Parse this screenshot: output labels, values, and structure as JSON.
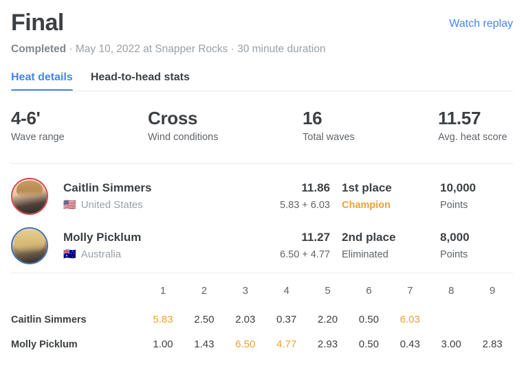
{
  "header": {
    "title": "Final",
    "watch_replay_label": "Watch replay",
    "status": "Completed",
    "meta": " · May 10, 2022 at Snapper Rocks · 30 minute duration"
  },
  "tabs": [
    {
      "label": "Heat details",
      "active": true
    },
    {
      "label": "Head-to-head stats",
      "active": false
    }
  ],
  "stats": [
    {
      "value": "4-6'",
      "label": "Wave range"
    },
    {
      "value": "Cross",
      "label": "Wind conditions"
    },
    {
      "value": "16",
      "label": "Total waves"
    },
    {
      "value": "11.57",
      "label": "Avg. heat score"
    }
  ],
  "athletes": [
    {
      "name": "Caitlin Simmers",
      "country": "United States",
      "flag": "🇺🇸",
      "jersey_color": "#d94a4a",
      "score": "11.86",
      "wave_sum": "5.83 + 6.03",
      "place": "1st place",
      "status": "Champion",
      "status_is_champion": true,
      "points": "10,000",
      "points_label": "Points"
    },
    {
      "name": "Molly Picklum",
      "country": "Australia",
      "flag": "🇦🇺",
      "jersey_color": "#3f6fb5",
      "score": "11.27",
      "wave_sum": "6.50 + 4.77",
      "place": "2nd place",
      "status": "Eliminated",
      "status_is_champion": false,
      "points": "8,000",
      "points_label": "Points"
    }
  ],
  "wave_table": {
    "columns": [
      "1",
      "2",
      "3",
      "4",
      "5",
      "6",
      "7",
      "8",
      "9"
    ],
    "rows": [
      {
        "name": "Caitlin Simmers",
        "scores": [
          "5.83",
          "2.50",
          "2.03",
          "0.37",
          "2.20",
          "0.50",
          "6.03",
          "",
          ""
        ],
        "best": [
          0,
          6
        ]
      },
      {
        "name": "Molly Picklum",
        "scores": [
          "1.00",
          "1.43",
          "6.50",
          "4.77",
          "2.93",
          "0.50",
          "0.43",
          "3.00",
          "2.83"
        ],
        "best": [
          2,
          3
        ]
      }
    ]
  },
  "colors": {
    "accent_blue": "#4285f4",
    "champion_orange": "#f0a030",
    "text_dark": "#3c4043",
    "text_muted": "#5f6368",
    "text_light": "#9aa0a6",
    "divider": "#e8eaed"
  }
}
